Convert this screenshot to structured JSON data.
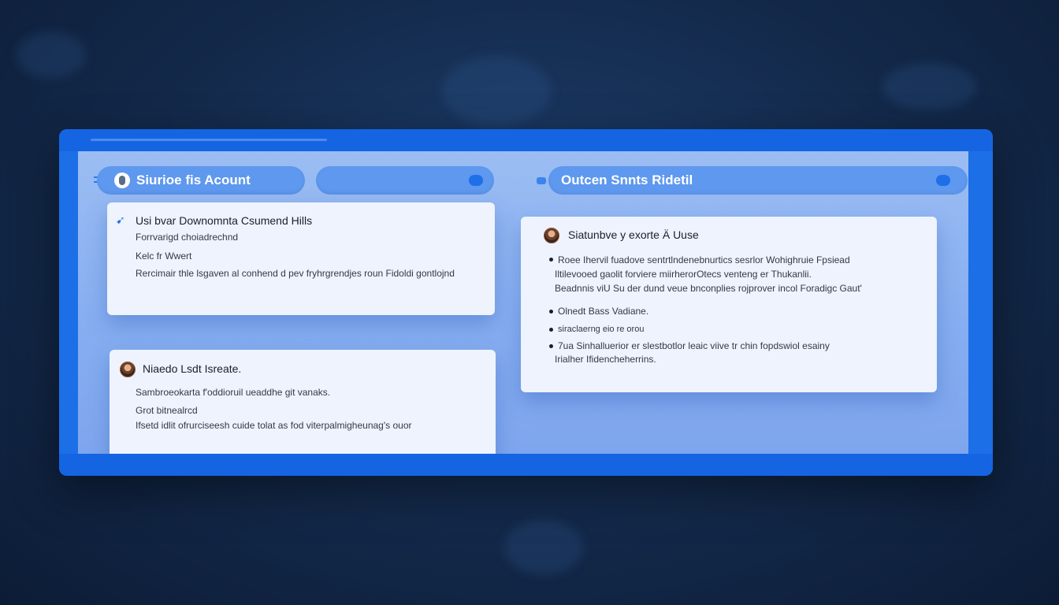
{
  "left_panel": {
    "header": {
      "title": "Siurioe fis Acount"
    },
    "card1": {
      "title": "Usi bvar Downomnta Csumend Hills",
      "lines": [
        "Forrvarigd choiadrechnd",
        "Kelc fr  Wwert",
        "Rercimair thle lsgaven al conhend d pev fryhrgrendjes roun Fidoldi gontlojnd"
      ]
    },
    "card2": {
      "title": "Niaedo Lsdt Isreate.",
      "lines": [
        "Sambroeokarta  f'oddioruil ueaddhe git vanaks.",
        "Grot bitnealrcd",
        "Ifsetd idlit ofrurciseesh cuide tolat as fod viterpalmigheunag's ouor"
      ]
    }
  },
  "right_panel": {
    "header": {
      "title": "Outcen Snnts Ridetil"
    },
    "card": {
      "title": "Siatunbve  y  exorte Ä Uuse",
      "bullets": [
        [
          "Roee  Ihervil fuadove sentrtlndenebnurtics sesrlor Wohighruie Fpsiead",
          "Iltilevooed gaolit forviere miirherorOtecs venteng er Thukanlii.",
          "Beadnnis viU Su der dund veue bnconplies rojprover incol Foradigc Gaut'"
        ],
        [
          "Olnedt Bass Vadiane."
        ],
        [
          "siraclaerng eio re orou"
        ],
        [
          "7ua Sinhalluerior er slestbotlor leaic viive tr chin fopdswiol esainy",
          "Irialher Ifidencheherrins."
        ]
      ]
    }
  },
  "colors": {
    "window": "#1c6fe6",
    "inner": "#9bbdf3",
    "pill": "#5e98ef",
    "card": "#eef3fd"
  }
}
